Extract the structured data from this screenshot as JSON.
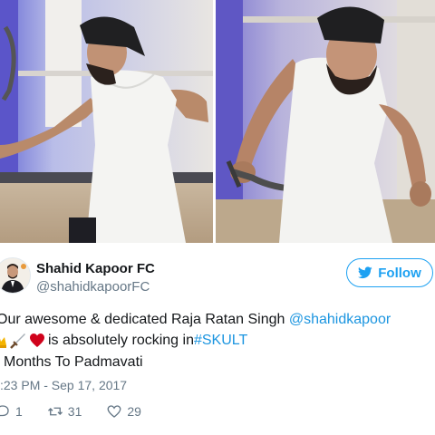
{
  "tweet": {
    "display_name": "Shahid Kapoor FC",
    "handle": "@shahidkapoorFC",
    "follow_label": "Follow",
    "line1_text": "Our awesome & dedicated Raja Ratan Singh ",
    "line1_mention": "@shahidkapoor",
    "line2_text": " is absolutely rocking in ",
    "line2_hashtag": "#SKULT",
    "line3_text": "Months To Padmavati",
    "timestamp": ":23 PM - Sep 17, 2017",
    "replies": "1",
    "retweets": "31",
    "likes": "29"
  },
  "icons": {
    "follow": "twitter-bird-icon",
    "emojis": [
      "crown-icon",
      "dagger-icon",
      "heart-icon"
    ],
    "reply": "reply-icon",
    "retweet": "retweet-icon",
    "like": "like-icon"
  },
  "colors": {
    "link": "#1b95e0",
    "follow_blue": "#1da1f2",
    "muted": "#657786",
    "text": "#14171a",
    "heart": "#d0021b"
  }
}
